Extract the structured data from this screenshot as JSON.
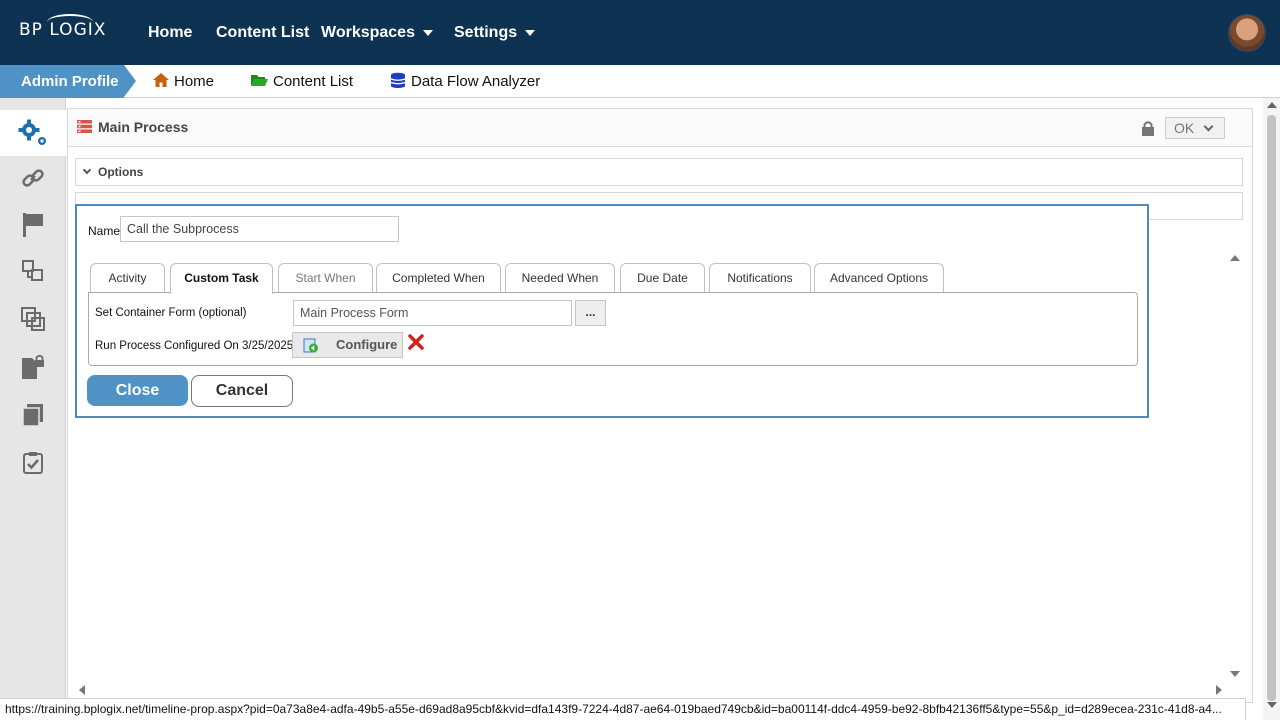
{
  "app": {
    "logo_text": "BP LOGIX",
    "brand_color": "#0e3352",
    "accent_color": "#4f93c6"
  },
  "topnav": {
    "home": "Home",
    "content_list": "Content List",
    "workspaces": "Workspaces",
    "settings": "Settings"
  },
  "breadcrumb": {
    "profile": "Admin Profile",
    "home": "Home",
    "content_list": "Content List",
    "data_flow": "Data Flow Analyzer"
  },
  "sidebar": {
    "items": [
      {
        "icon": "gears-icon",
        "active": true
      },
      {
        "icon": "link-icon"
      },
      {
        "icon": "flag-icon"
      },
      {
        "icon": "hierarchy-icon"
      },
      {
        "icon": "stack-icon"
      },
      {
        "icon": "locked-document-icon"
      },
      {
        "icon": "copy-icon"
      },
      {
        "icon": "checked-document-icon"
      }
    ]
  },
  "panel": {
    "title": "Main Process",
    "ok_label": "OK",
    "options_label": "Options"
  },
  "dialog": {
    "name_label": "Name",
    "name_value": "Call the Subprocess",
    "tabs": [
      {
        "label": "Activity"
      },
      {
        "label": "Custom Task"
      },
      {
        "label": "Start When"
      },
      {
        "label": "Completed When"
      },
      {
        "label": "Needed When"
      },
      {
        "label": "Due Date"
      },
      {
        "label": "Notifications"
      },
      {
        "label": "Advanced Options"
      }
    ],
    "active_tab": "Custom Task",
    "container_label": "Set Container Form (optional)",
    "container_value": "Main Process Form",
    "browse_label": "...",
    "run_label": "Run Process Configured On 3/25/2025",
    "configure_label": "Configure",
    "close_label": "Close",
    "cancel_label": "Cancel"
  },
  "status_url": "https://training.bplogix.net/timeline-prop.aspx?pid=0a73a8e4-adfa-49b5-a55e-d69ad8a95cbf&kvid=dfa143f9-7224-4d87-ae64-019baed749cb&id=ba00114f-ddc4-4959-be92-8bfb42136ff5&type=55&p_id=d289ecea-231c-41d8-a4..."
}
